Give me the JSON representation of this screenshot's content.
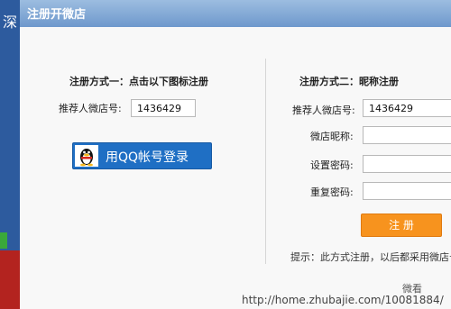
{
  "background": {
    "side_glyph": "深"
  },
  "dialog": {
    "title": "注册开微店",
    "left": {
      "heading": "注册方式一：点击以下图标注册",
      "referrer_label": "推荐人微店号:",
      "referrer_value": "1436429",
      "qq_button_label": "用QQ帐号登录"
    },
    "right": {
      "heading": "注册方式二：昵称注册",
      "referrer_label": "推荐人微店号:",
      "referrer_value": "1436429",
      "nickname_label": "微店昵称:",
      "nickname_value": "",
      "password_label": "设置密码:",
      "password_value": "",
      "confirm_label": "重复密码:",
      "confirm_value": "",
      "register_button_label": "注 册",
      "tip": "提示：此方式注册，以后都采用微店号"
    }
  },
  "watermark": {
    "line1": "微看",
    "line2": "http://home.zhubajie.com/10081884/"
  },
  "colors": {
    "titlebar": "#7fa6d6",
    "qq_button": "#1f6fc4",
    "register_button": "#f7931e",
    "left_strip": "#2d5b9e"
  }
}
